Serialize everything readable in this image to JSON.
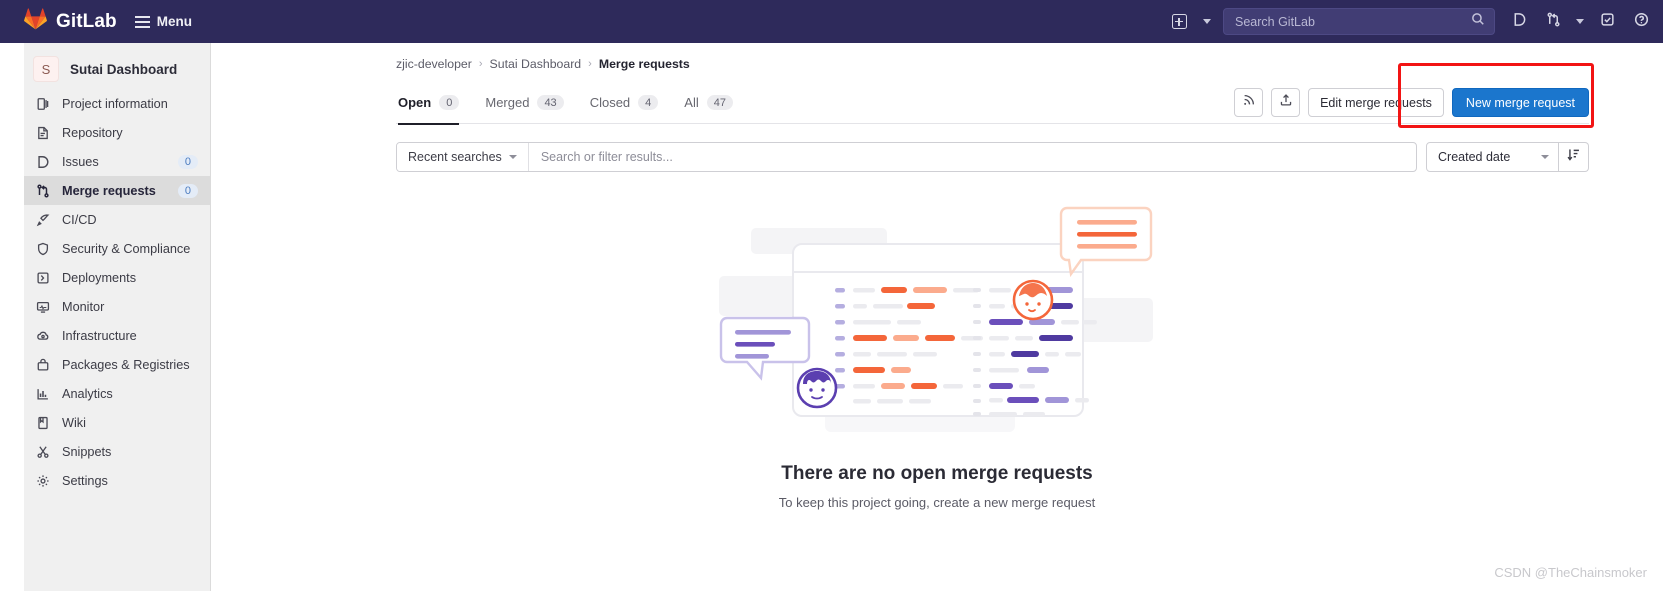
{
  "navbar": {
    "brand": "GitLab",
    "menu_label": "Menu",
    "logo_icon": "gitlab-tanuki-icon",
    "hamburger_icon": "hamburger-menu-icon",
    "new_item_icon": "plus-square-icon",
    "new_item_caret_icon": "chevron-down-icon",
    "search_placeholder": "Search GitLab",
    "search_icon": "magnifier-icon",
    "issues_icon": "issues-icon",
    "merge_requests_icon": "merge-request-icon",
    "merge_requests_caret_icon": "chevron-down-icon",
    "todos_icon": "todo-checkmark-icon",
    "help_icon": "help-circle-icon",
    "bg_color": "#2e2a5b"
  },
  "sidebar": {
    "project": {
      "initial": "S",
      "name": "Sutai Dashboard"
    },
    "items": [
      {
        "label": "Project information",
        "icon": "project-information-icon",
        "badge": null,
        "active": false
      },
      {
        "label": "Repository",
        "icon": "repository-doc-icon",
        "badge": null,
        "active": false
      },
      {
        "label": "Issues",
        "icon": "issues-icon",
        "badge": "0",
        "active": false
      },
      {
        "label": "Merge requests",
        "icon": "merge-request-icon",
        "badge": "0",
        "active": true
      },
      {
        "label": "CI/CD",
        "icon": "rocket-icon",
        "badge": null,
        "active": false
      },
      {
        "label": "Security & Compliance",
        "icon": "shield-icon",
        "badge": null,
        "active": false
      },
      {
        "label": "Deployments",
        "icon": "deployments-icon",
        "badge": null,
        "active": false
      },
      {
        "label": "Monitor",
        "icon": "monitor-icon",
        "badge": null,
        "active": false
      },
      {
        "label": "Infrastructure",
        "icon": "cloud-gear-icon",
        "badge": null,
        "active": false
      },
      {
        "label": "Packages & Registries",
        "icon": "package-box-icon",
        "badge": null,
        "active": false
      },
      {
        "label": "Analytics",
        "icon": "bar-chart-icon",
        "badge": null,
        "active": false
      },
      {
        "label": "Wiki",
        "icon": "book-icon",
        "badge": null,
        "active": false
      },
      {
        "label": "Snippets",
        "icon": "scissors-icon",
        "badge": null,
        "active": false
      },
      {
        "label": "Settings",
        "icon": "gear-icon",
        "badge": null,
        "active": false
      }
    ]
  },
  "breadcrumb": {
    "items": [
      "zjic-developer",
      "Sutai Dashboard",
      "Merge requests"
    ],
    "separator": "›"
  },
  "tabs": [
    {
      "label": "Open",
      "count": "0",
      "active": true
    },
    {
      "label": "Merged",
      "count": "43",
      "active": false
    },
    {
      "label": "Closed",
      "count": "4",
      "active": false
    },
    {
      "label": "All",
      "count": "47",
      "active": false
    }
  ],
  "tab_actions": {
    "rss_icon": "rss-feed-icon",
    "export_icon": "export-upload-icon",
    "edit_label": "Edit merge requests",
    "new_label": "New merge request",
    "new_button_color": "#1b76cd",
    "highlight_color": "#f21414"
  },
  "filter": {
    "recent_searches_label": "Recent searches",
    "recent_searches_caret_icon": "chevron-down-icon",
    "search_placeholder": "Search or filter results...",
    "sort_value": "Created date",
    "sort_caret_icon": "chevron-down-icon",
    "sort_direction_icon": "sort-descending-icon"
  },
  "empty_state": {
    "illustration": "merge-request-empty-illustration",
    "title": "There are no open merge requests",
    "subtitle": "To keep this project going, create a new merge request",
    "accent_orange": "#f4663a",
    "accent_purple": "#6b4fbb"
  },
  "watermark": {
    "text": "CSDN @TheChainsmoker"
  }
}
